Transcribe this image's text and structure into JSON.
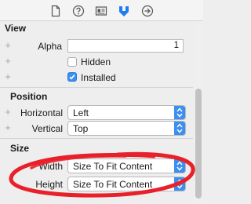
{
  "toolbar": {
    "icons": [
      "file-inspector-icon",
      "quick-help-icon",
      "identity-inspector-icon",
      "attributes-inspector-icon",
      "connections-inspector-icon"
    ]
  },
  "view_section": {
    "title": "View",
    "alpha_label": "Alpha",
    "alpha_value": "1",
    "hidden_label": "Hidden",
    "hidden_checked": false,
    "installed_label": "Installed",
    "installed_checked": true
  },
  "position_section": {
    "title": "Position",
    "horizontal_label": "Horizontal",
    "horizontal_value": "Left",
    "vertical_label": "Vertical",
    "vertical_value": "Top"
  },
  "size_section": {
    "title": "Size",
    "width_label": "Width",
    "width_value": "Size To Fit Content",
    "height_label": "Height",
    "height_value": "Size To Fit Content"
  },
  "colors": {
    "accent": "#3b8ff1",
    "annotation": "#e8202a",
    "selected_tab": "#1f7cf0"
  }
}
